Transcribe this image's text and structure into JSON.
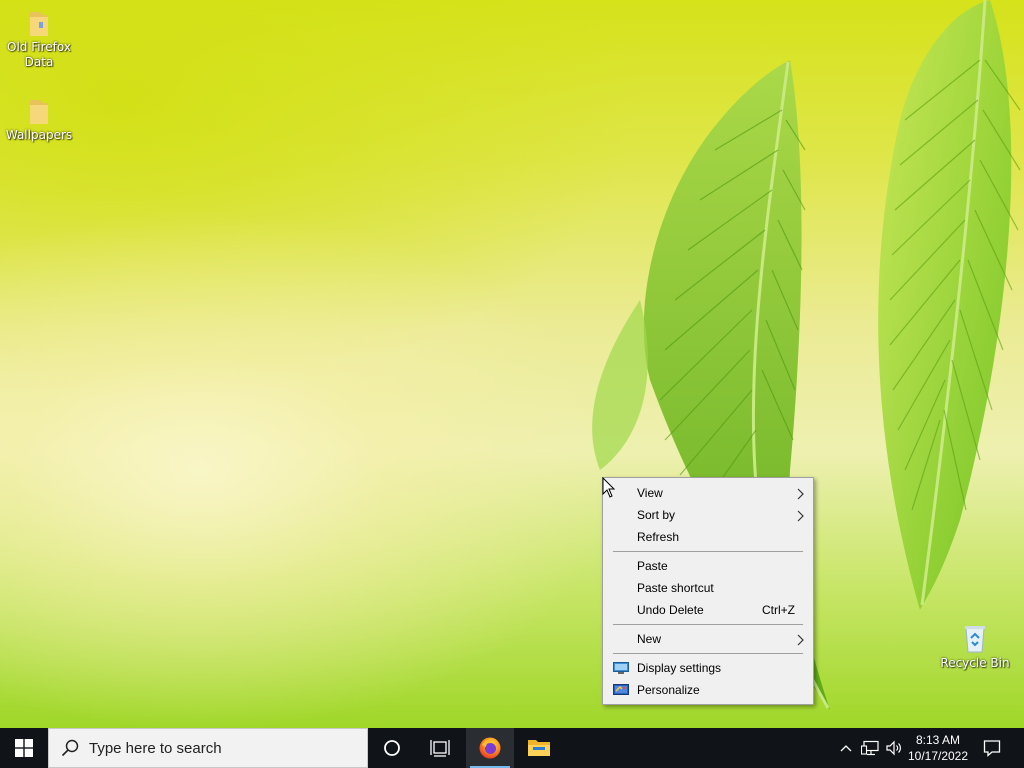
{
  "desktop": {
    "icons": [
      {
        "label_line1": "Old Firefox",
        "label_line2": "Data",
        "icon": "folder-icon"
      },
      {
        "label": "Wallpapers",
        "icon": "folder-icon"
      },
      {
        "label": "Recycle Bin",
        "icon": "recycle-bin-icon"
      }
    ]
  },
  "context_menu": {
    "view": "View",
    "sort_by": "Sort by",
    "refresh": "Refresh",
    "paste": "Paste",
    "paste_shortcut": "Paste shortcut",
    "undo_delete": "Undo Delete",
    "undo_delete_shortcut": "Ctrl+Z",
    "new": "New",
    "display_settings": "Display settings",
    "personalize": "Personalize"
  },
  "taskbar": {
    "search_placeholder": "Type here to search",
    "apps": [
      "cortana-icon",
      "task-view-icon",
      "firefox-icon",
      "file-explorer-icon"
    ],
    "clock_time": "8:13 AM",
    "clock_date": "10/17/2022",
    "tray": [
      "chevron-up-icon",
      "network-icon",
      "volume-icon",
      "notification-icon"
    ]
  },
  "colors": {
    "taskbar": "#101418",
    "menu_bg": "#f0f0f0",
    "accent": "#76b9ed"
  }
}
